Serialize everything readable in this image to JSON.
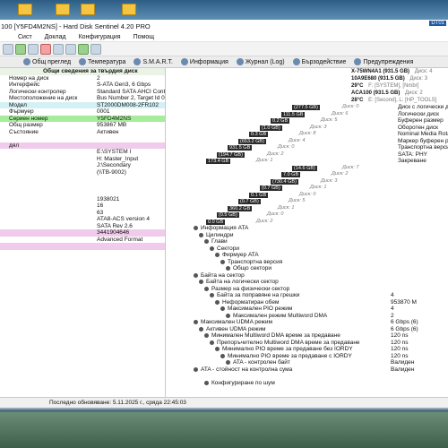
{
  "window": {
    "title": "100 [Y5FD4M2NS] - Hard Disk Sentinel 4.20 PRO",
    "corner_label": "DT01"
  },
  "menu": [
    "Сист",
    "Доклад",
    "Конфигурация",
    "Помощ"
  ],
  "tabs": [
    {
      "label": "Общ преглед",
      "icon": "overview-icon"
    },
    {
      "label": "Температура",
      "icon": "temperature-icon"
    },
    {
      "label": "S.M.A.R.T.",
      "icon": "smart-icon"
    },
    {
      "label": "Информация",
      "icon": "info-icon"
    },
    {
      "label": "Журнал (Log)",
      "icon": "log-icon"
    },
    {
      "label": "Бързодействие",
      "icon": "performance-icon"
    },
    {
      "label": "Предупреждения",
      "icon": "alerts-icon"
    }
  ],
  "left_rows": [
    {
      "label": "Общи сведения за твърдия диск",
      "value": "",
      "style": "hdr"
    },
    {
      "label": "Номер на диск",
      "value": "2",
      "style": ""
    },
    {
      "label": "Интерфейс",
      "value": "S-ATA Gen3, 6 Gbps",
      "style": ""
    },
    {
      "label": "Логически контролер",
      "value": "Standard SATA AHCI Controller (AHCI)",
      "style": ""
    },
    {
      "label": "Местоположение на диск",
      "value": "Bus Number 2, Target Id 0, LUN 0",
      "style": ""
    },
    {
      "label": "Модел",
      "value": "ST2000DM008-2FR102",
      "style": "cyan"
    },
    {
      "label": "Фърмуер",
      "value": "0001",
      "style": ""
    },
    {
      "label": "Сериен номер",
      "value": "Y5FD4M2NS",
      "style": "green"
    },
    {
      "label": "Общ размер",
      "value": "953867 MB",
      "style": ""
    },
    {
      "label": "Състояние",
      "value": "Активен",
      "style": ""
    },
    {
      "label": "",
      "value": "",
      "style": ""
    },
    {
      "label": "дял",
      "value": "",
      "style": "pink"
    },
    {
      "label": "",
      "value": "E:\\SYSTEM I",
      "style": ""
    },
    {
      "label": "",
      "value": "H: Master_Input",
      "style": ""
    },
    {
      "label": "",
      "value": "J:\\Secondary",
      "style": ""
    },
    {
      "label": "",
      "value": "(\\\\TB-9002)",
      "style": ""
    },
    {
      "label": "",
      "value": "",
      "style": ""
    },
    {
      "label": "",
      "value": "",
      "style": ""
    },
    {
      "label": "",
      "value": "",
      "style": ""
    },
    {
      "label": "",
      "value": "1938021",
      "style": ""
    },
    {
      "label": "",
      "value": "16",
      "style": ""
    },
    {
      "label": "",
      "value": "63",
      "style": ""
    },
    {
      "label": "",
      "value": "ATA8-ACS version 4",
      "style": ""
    },
    {
      "label": "",
      "value": "SATA Rev 2.6",
      "style": ""
    },
    {
      "label": "",
      "value": "3441904646",
      "style": "pink"
    },
    {
      "label": "",
      "value": "Advanced Format",
      "style": ""
    },
    {
      "label": "",
      "value": "",
      "style": "pink"
    }
  ],
  "right_header_rows": [
    {
      "text": "X-75WN4A1 (931.5 GB)",
      "extra": "Диск: 4"
    },
    {
      "text": "10A9E680 (931.5 GB)",
      "extra": "Диск: 3"
    },
    {
      "text": "29°C",
      "extra": "F: [SYSTEM], [Nmbr]"
    },
    {
      "text": "ACA100 (931.5 GB)",
      "extra": "Диск: 2"
    },
    {
      "text": "28°C",
      "extra": "E: [Second], L: [HP_TOOLS]"
    }
  ],
  "partition_bars": [
    {
      "text": "(277.5 GB)",
      "label": "Диск: 0"
    },
    {
      "text": "111.5 GB",
      "label": "Диск: 6"
    },
    {
      "text": "0.2 GB",
      "label": "Диск: 5"
    },
    {
      "text": "(1.0 GB)",
      "label": "Диск: 3"
    },
    {
      "text": "0.3 GB",
      "label": "Диск: 8"
    },
    {
      "text": "(653.2 GB)",
      "label": "Диск: 4"
    },
    {
      "text": "931.5 GB",
      "label": "Диск: 0"
    },
    {
      "text": "(194.7 GB)",
      "label": "Диск: 2"
    },
    {
      "text": "173.4 GB",
      "label": "Диск: 1"
    },
    {
      "text": "(14.6 GB)",
      "label": "Диск: 7"
    },
    {
      "text": "7.0 GB",
      "label": "Диск: 2"
    },
    {
      "text": "(730.4 GB)",
      "label": "Диск: 3"
    },
    {
      "text": "(0.7 GB)",
      "label": "Диск: 1"
    },
    {
      "text": "0.1 GB",
      "label": "Диск: 0"
    },
    {
      "text": "(0.7 GB)",
      "label": "Диск: 5"
    },
    {
      "text": "360.2 GB",
      "label": "Диск: 1"
    },
    {
      "text": "(0.5 GB)",
      "label": "Диск: 0"
    },
    {
      "text": "0.0 GB",
      "label": "Диск: 2"
    }
  ],
  "info_rows": [
    {
      "label": "Информация ATA",
      "value": ""
    },
    {
      "label": "Цилиндри",
      "value": ""
    },
    {
      "label": "Глави",
      "value": ""
    },
    {
      "label": "Сектори",
      "value": ""
    },
    {
      "label": "Фирмуер ATA",
      "value": ""
    },
    {
      "label": "Транспортна версия",
      "value": ""
    },
    {
      "label": "Общо сектори",
      "value": ""
    },
    {
      "label": "Байта на сектор",
      "value": ""
    },
    {
      "label": "Байта на логически сектор",
      "value": ""
    },
    {
      "label": "Размер на физически сектор",
      "value": ""
    },
    {
      "label": "Байта за поправяне на грешки",
      "value": "4"
    },
    {
      "label": "Неформатиран обем",
      "value": "953870 M"
    },
    {
      "label": "Максимален PIO режим",
      "value": "4"
    },
    {
      "label": "Максимален режим Multiword DMA",
      "value": "2"
    },
    {
      "label": "Максимален UDMA режим",
      "value": "6 Gbps (6)"
    },
    {
      "label": "Активен UDMA режим",
      "value": "6 Gbps (6)"
    },
    {
      "label": "Минимален Multiword DMA време за предаване",
      "value": "120 ns"
    },
    {
      "label": "Препоръчително Multiword DMA време за предаване",
      "value": "120 ns"
    },
    {
      "label": "Минимално PIO време за предаване без IORDY",
      "value": "120 ns"
    },
    {
      "label": "Минимално PIO време за предаване с IORDY",
      "value": "120 ns"
    },
    {
      "label": "ATA - контролен байт",
      "value": "Валиден"
    },
    {
      "label": "ATA - стойност на контролна сума",
      "value": "Валиден"
    },
    {
      "label": "",
      "value": ""
    },
    {
      "label": "Конфигуриране по шум",
      "value": ""
    }
  ],
  "right_extras": [
    {
      "text": "Диск с логически дял"
    },
    {
      "text": "Логически диск"
    },
    {
      "text": "Буферен размер"
    },
    {
      "text": "Оборотен диск"
    },
    {
      "text": "Nominal Media Rotation"
    },
    {
      "text": "Маркер буферен ред"
    },
    {
      "text": "Транспортна версия"
    },
    {
      "text": "SATA: PHY"
    },
    {
      "text": "Закреване"
    }
  ],
  "status_bar": "Последно обновяване: 5.11.2025 г., сряда 22:45:03"
}
